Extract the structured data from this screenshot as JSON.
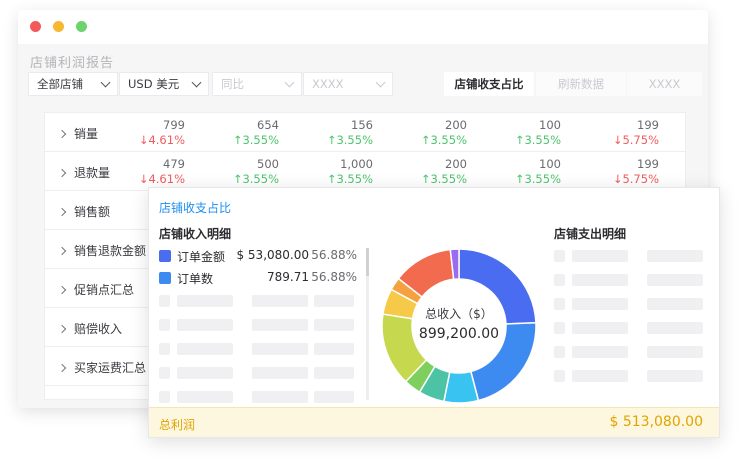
{
  "window": {
    "title": "店铺利润报告"
  },
  "filters": {
    "store": "全部店铺",
    "currency": "USD 美元",
    "compare": "同比",
    "extra": "XXXX",
    "btn_share": "店铺收支占比",
    "btn_refresh": "刷新数据",
    "btn_extra": "XXXX"
  },
  "table": {
    "rows": [
      {
        "label": "销量",
        "cells": [
          {
            "value": "799",
            "change": "↓4.61%",
            "dir": "down"
          },
          {
            "value": "654",
            "change": "↑3.55%",
            "dir": "up"
          },
          {
            "value": "156",
            "change": "↑3.55%",
            "dir": "up"
          },
          {
            "value": "200",
            "change": "↑3.55%",
            "dir": "up"
          },
          {
            "value": "100",
            "change": "↑3.55%",
            "dir": "up"
          },
          {
            "value": "199",
            "change": "↓5.75%",
            "dir": "down"
          }
        ]
      },
      {
        "label": "退款量",
        "cells": [
          {
            "value": "479",
            "change": "↓4.61%",
            "dir": "down"
          },
          {
            "value": "500",
            "change": "↑3.55%",
            "dir": "up"
          },
          {
            "value": "1,000",
            "change": "↑3.55%",
            "dir": "up"
          },
          {
            "value": "200",
            "change": "↑3.55%",
            "dir": "up"
          },
          {
            "value": "100",
            "change": "↑3.55%",
            "dir": "up"
          },
          {
            "value": "199",
            "change": "↓5.75%",
            "dir": "down"
          }
        ]
      },
      {
        "label": "销售额",
        "cells": []
      },
      {
        "label": "销售退款金额",
        "cells": []
      },
      {
        "label": "促销点汇总",
        "cells": []
      },
      {
        "label": "赔偿收入",
        "cells": []
      },
      {
        "label": "买家运费汇总",
        "cells": []
      }
    ]
  },
  "card": {
    "title": "店铺收支占比",
    "income_title": "店铺收入明细",
    "expense_title": "店铺支出明细",
    "legend": [
      {
        "name": "订单金额",
        "value": "$ 53,080.00",
        "pct": "56.88%",
        "color": "#4a6cf0"
      },
      {
        "name": "订单数",
        "value": "789.71",
        "pct": "56.88%",
        "color": "#3d8bf0"
      }
    ],
    "donut": {
      "center_label": "总收入（$）",
      "center_value": "899,200.00",
      "segments": [
        {
          "value": 27,
          "color": "#4a6cf0"
        },
        {
          "value": 24,
          "color": "#3d8bf0"
        },
        {
          "value": 8,
          "color": "#38c3f0"
        },
        {
          "value": 6,
          "color": "#4cc3a5"
        },
        {
          "value": 4,
          "color": "#7fcf5e"
        },
        {
          "value": 17,
          "color": "#c6d94e"
        },
        {
          "value": 6,
          "color": "#f7c948"
        },
        {
          "value": 3,
          "color": "#f5a142"
        },
        {
          "value": 14,
          "color": "#f26b4f"
        },
        {
          "value": 2,
          "color": "#9a6cf0"
        }
      ]
    },
    "footer": {
      "label": "总利润",
      "value": "$ 513,080.00"
    }
  }
}
